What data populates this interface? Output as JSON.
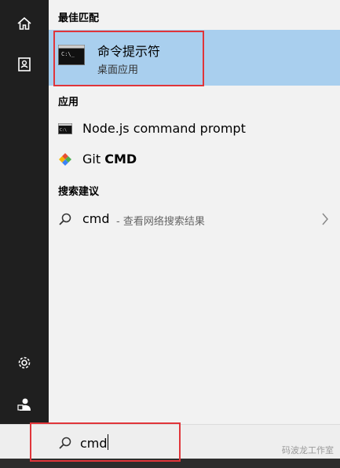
{
  "rail": {
    "icons": [
      "home-icon",
      "document-icon",
      "settings-icon",
      "user-icon"
    ]
  },
  "sections": {
    "best_match": "最佳匹配",
    "apps": "应用",
    "search_suggestions": "搜索建议"
  },
  "best_match": {
    "title": "命令提示符",
    "subtitle": "桌面应用",
    "icon": "terminal-icon"
  },
  "apps": [
    {
      "prefix": "Node.js command prompt",
      "bold": "",
      "icon": "terminal-small-icon"
    },
    {
      "prefix": "Git ",
      "bold": "CMD",
      "icon": "git-icon"
    }
  ],
  "suggestion": {
    "query": "cmd",
    "hint": " - 查看网络搜索结果",
    "icon": "search-icon"
  },
  "search": {
    "value": "cmd",
    "placeholder": ""
  },
  "watermark": "码波龙工作室",
  "colors": {
    "selection": "#a9cfee",
    "highlight": "#e0353a",
    "rail": "#1f1f1f"
  }
}
